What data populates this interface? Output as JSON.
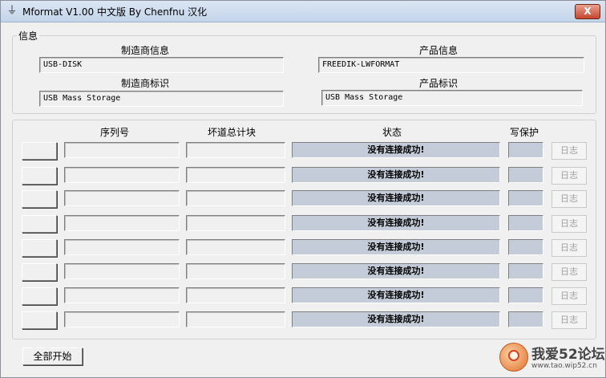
{
  "window": {
    "title": "Mformat V1.00 中文版 By Chenfnu 汉化",
    "close_label": "X",
    "icon": "usb-plug-icon"
  },
  "info": {
    "group_label": "信息",
    "manufacturer_info_label": "制造商信息",
    "manufacturer_info_value": "USB-DISK",
    "product_info_label": "产品信息",
    "product_info_value": "FREEDIK-LWFORMAT",
    "manufacturer_id_label": "制造商标识",
    "manufacturer_id_value": "USB Mass Storage",
    "product_id_label": "产品标识",
    "product_id_value": "USB Mass Storage"
  },
  "devices": {
    "headers": {
      "serial": "序列号",
      "bad_blocks": "坏道总计块",
      "status": "状态",
      "write_protect": "写保护"
    },
    "rows": [
      {
        "serial": "",
        "bad_blocks": "",
        "status": "没有连接成功!",
        "write_protect": "",
        "log_label": "日志"
      },
      {
        "serial": "",
        "bad_blocks": "",
        "status": "没有连接成功!",
        "write_protect": "",
        "log_label": "日志"
      },
      {
        "serial": "",
        "bad_blocks": "",
        "status": "没有连接成功!",
        "write_protect": "",
        "log_label": "日志"
      },
      {
        "serial": "",
        "bad_blocks": "",
        "status": "没有连接成功!",
        "write_protect": "",
        "log_label": "日志"
      },
      {
        "serial": "",
        "bad_blocks": "",
        "status": "没有连接成功!",
        "write_protect": "",
        "log_label": "日志"
      },
      {
        "serial": "",
        "bad_blocks": "",
        "status": "没有连接成功!",
        "write_protect": "",
        "log_label": "日志"
      },
      {
        "serial": "",
        "bad_blocks": "",
        "status": "没有连接成功!",
        "write_protect": "",
        "log_label": "日志"
      },
      {
        "serial": "",
        "bad_blocks": "",
        "status": "没有连接成功!",
        "write_protect": "",
        "log_label": "日志"
      }
    ]
  },
  "footer": {
    "start_all_label": "全部开始"
  },
  "watermark": {
    "text": "我爱52论坛",
    "url": "www.tao.wip52.cn"
  },
  "colors": {
    "status_bg": "#c3ccd8",
    "window_bg": "#f0f0f0",
    "close_red": "#c7462c"
  }
}
